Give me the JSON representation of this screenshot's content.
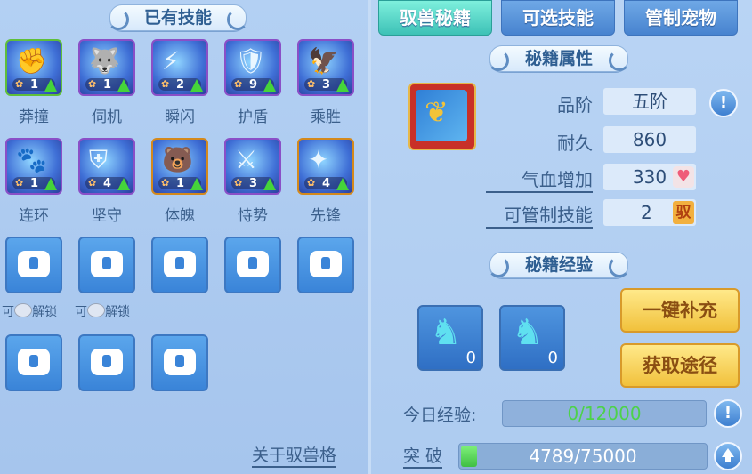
{
  "left": {
    "title": "已有技能",
    "skills": [
      {
        "name": "莽撞",
        "level": "1",
        "art": "✊",
        "frame": "green"
      },
      {
        "name": "伺机",
        "level": "1",
        "art": "🐺",
        "frame": "purple"
      },
      {
        "name": "瞬闪",
        "level": "2",
        "art": "⚡",
        "frame": "purple"
      },
      {
        "name": "护盾",
        "level": "9",
        "art": "🛡",
        "frame": "purple"
      },
      {
        "name": "乘胜",
        "level": "3",
        "art": "🦅",
        "frame": "purple"
      },
      {
        "name": "连环",
        "level": "1",
        "art": "🐾",
        "frame": "purple"
      },
      {
        "name": "坚守",
        "level": "4",
        "art": "⛨",
        "frame": "purple"
      },
      {
        "name": "体魄",
        "level": "1",
        "art": "🐻",
        "frame": "gold"
      },
      {
        "name": "恃势",
        "level": "3",
        "art": "⚔",
        "frame": "purple"
      },
      {
        "name": "先锋",
        "level": "4",
        "art": "✦",
        "frame": "gold"
      }
    ],
    "unlock_prefix": "可",
    "unlock_suffix": "解锁",
    "about_link": "关于驭兽格"
  },
  "tabs": [
    {
      "label": "驭兽秘籍",
      "active": true
    },
    {
      "label": "可选技能",
      "active": false
    },
    {
      "label": "管制宠物",
      "active": false
    }
  ],
  "right": {
    "attr_title": "秘籍属性",
    "attrs": [
      {
        "label": "品阶",
        "value": "五阶"
      },
      {
        "label": "耐久",
        "value": "860"
      },
      {
        "label": "气血增加",
        "value": "330"
      },
      {
        "label": "可管制技能",
        "value": "2"
      }
    ],
    "yu_badge": "驭",
    "heart_icon": "♥",
    "info_icon": "!",
    "exp_title": "秘籍经验",
    "exp_items": [
      {
        "count": "0"
      },
      {
        "count": "0"
      }
    ],
    "btn_refill": "一键补充",
    "btn_source": "获取途径",
    "today_label": "今日经验:",
    "today_value": "0/12000",
    "break_label": "突 破",
    "break_value": "4789/75000",
    "break_progress": 0.064
  }
}
